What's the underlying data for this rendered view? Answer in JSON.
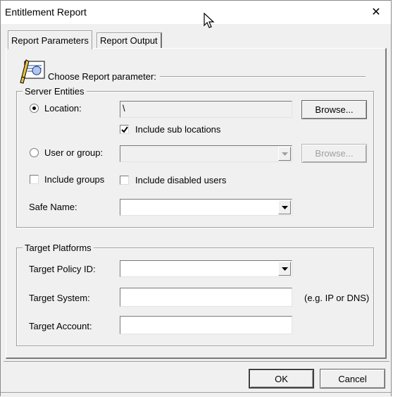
{
  "window": {
    "title": "Entitlement Report",
    "close_symbol": "✕"
  },
  "tabs": [
    {
      "label": "Report Parameters",
      "active": true
    },
    {
      "label": "Report Output",
      "active": false
    }
  ],
  "header": {
    "icon": "report-parameters-icon",
    "label": "Choose Report parameter:"
  },
  "server_entities": {
    "title": "Server Entities",
    "location": {
      "label": "Location:",
      "selected": true,
      "value": "\\",
      "browse_label": "Browse..."
    },
    "include_sub_locations": {
      "label": "Include sub locations",
      "checked": true
    },
    "user_or_group": {
      "label": "User or group:",
      "selected": false,
      "value": "",
      "browse_label": "Browse..."
    },
    "include_groups": {
      "label": "Include groups",
      "checked": false
    },
    "include_disabled_users": {
      "label": "Include disabled users",
      "checked": false
    },
    "safe_name": {
      "label": "Safe Name:",
      "value": ""
    }
  },
  "target_platforms": {
    "title": "Target Platforms",
    "policy_id": {
      "label": "Target Policy ID:",
      "value": ""
    },
    "system": {
      "label": "Target System:",
      "value": "",
      "hint": "(e.g. IP or DNS)"
    },
    "account": {
      "label": "Target Account:",
      "value": ""
    }
  },
  "footer": {
    "ok_label": "OK",
    "cancel_label": "Cancel"
  }
}
